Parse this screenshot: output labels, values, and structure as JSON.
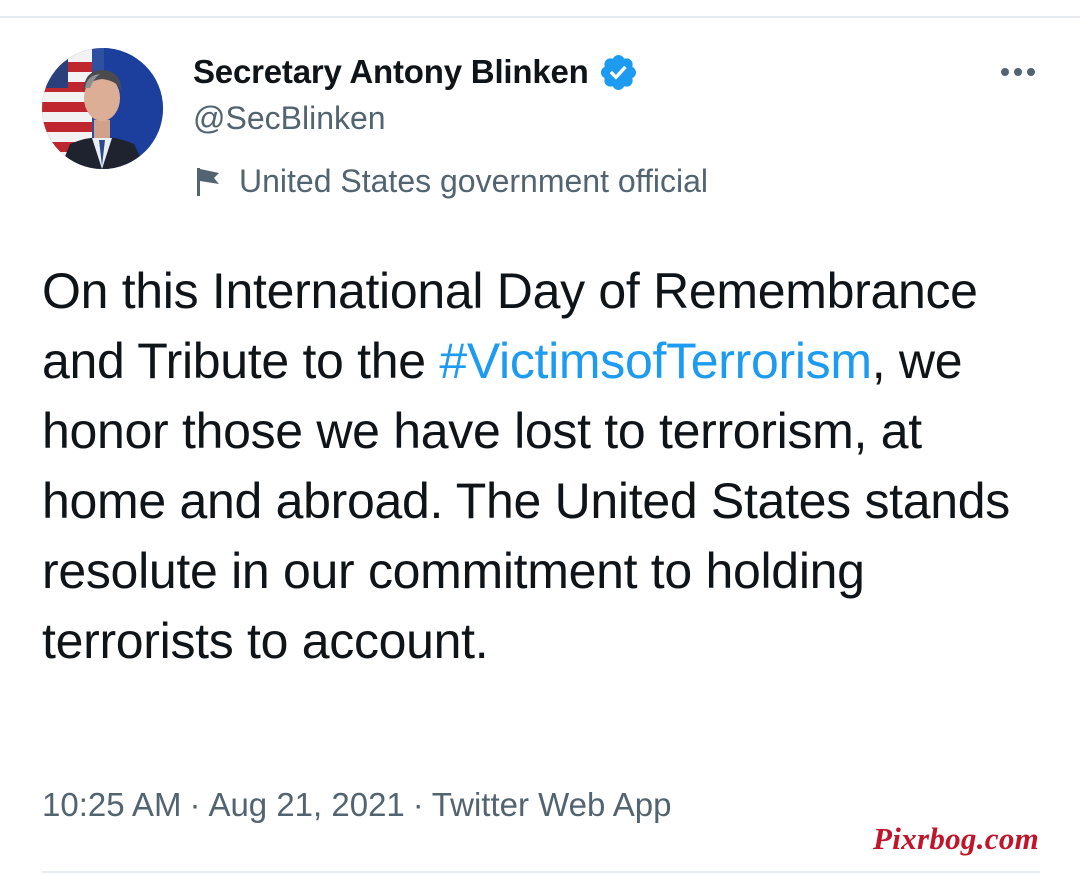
{
  "author": {
    "display_name": "Secretary Antony Blinken",
    "handle": "@SecBlinken",
    "verified": true,
    "label": "United States government official",
    "avatar_icon": "profile-photo",
    "verified_icon": "verified-badge-icon",
    "label_icon": "flag-icon"
  },
  "tweet": {
    "text_before": "On this International Day of Remembrance and Tribute to the ",
    "hashtag": "#VictimsofTerrorism",
    "text_after": ", we honor those we have lost to terrorism, at home and abroad. The United States stands resolute in our commitment to holding terrorists to account."
  },
  "meta": {
    "time": "10:25 AM",
    "date": "Aug 21, 2021",
    "source": "Twitter Web App",
    "separator": "·"
  },
  "watermark": "Pixrbog.com",
  "colors": {
    "text": "#0f1419",
    "secondary": "#536471",
    "link": "#1d9bf0",
    "verified": "#1d9bf0",
    "watermark": "#c0152a"
  }
}
